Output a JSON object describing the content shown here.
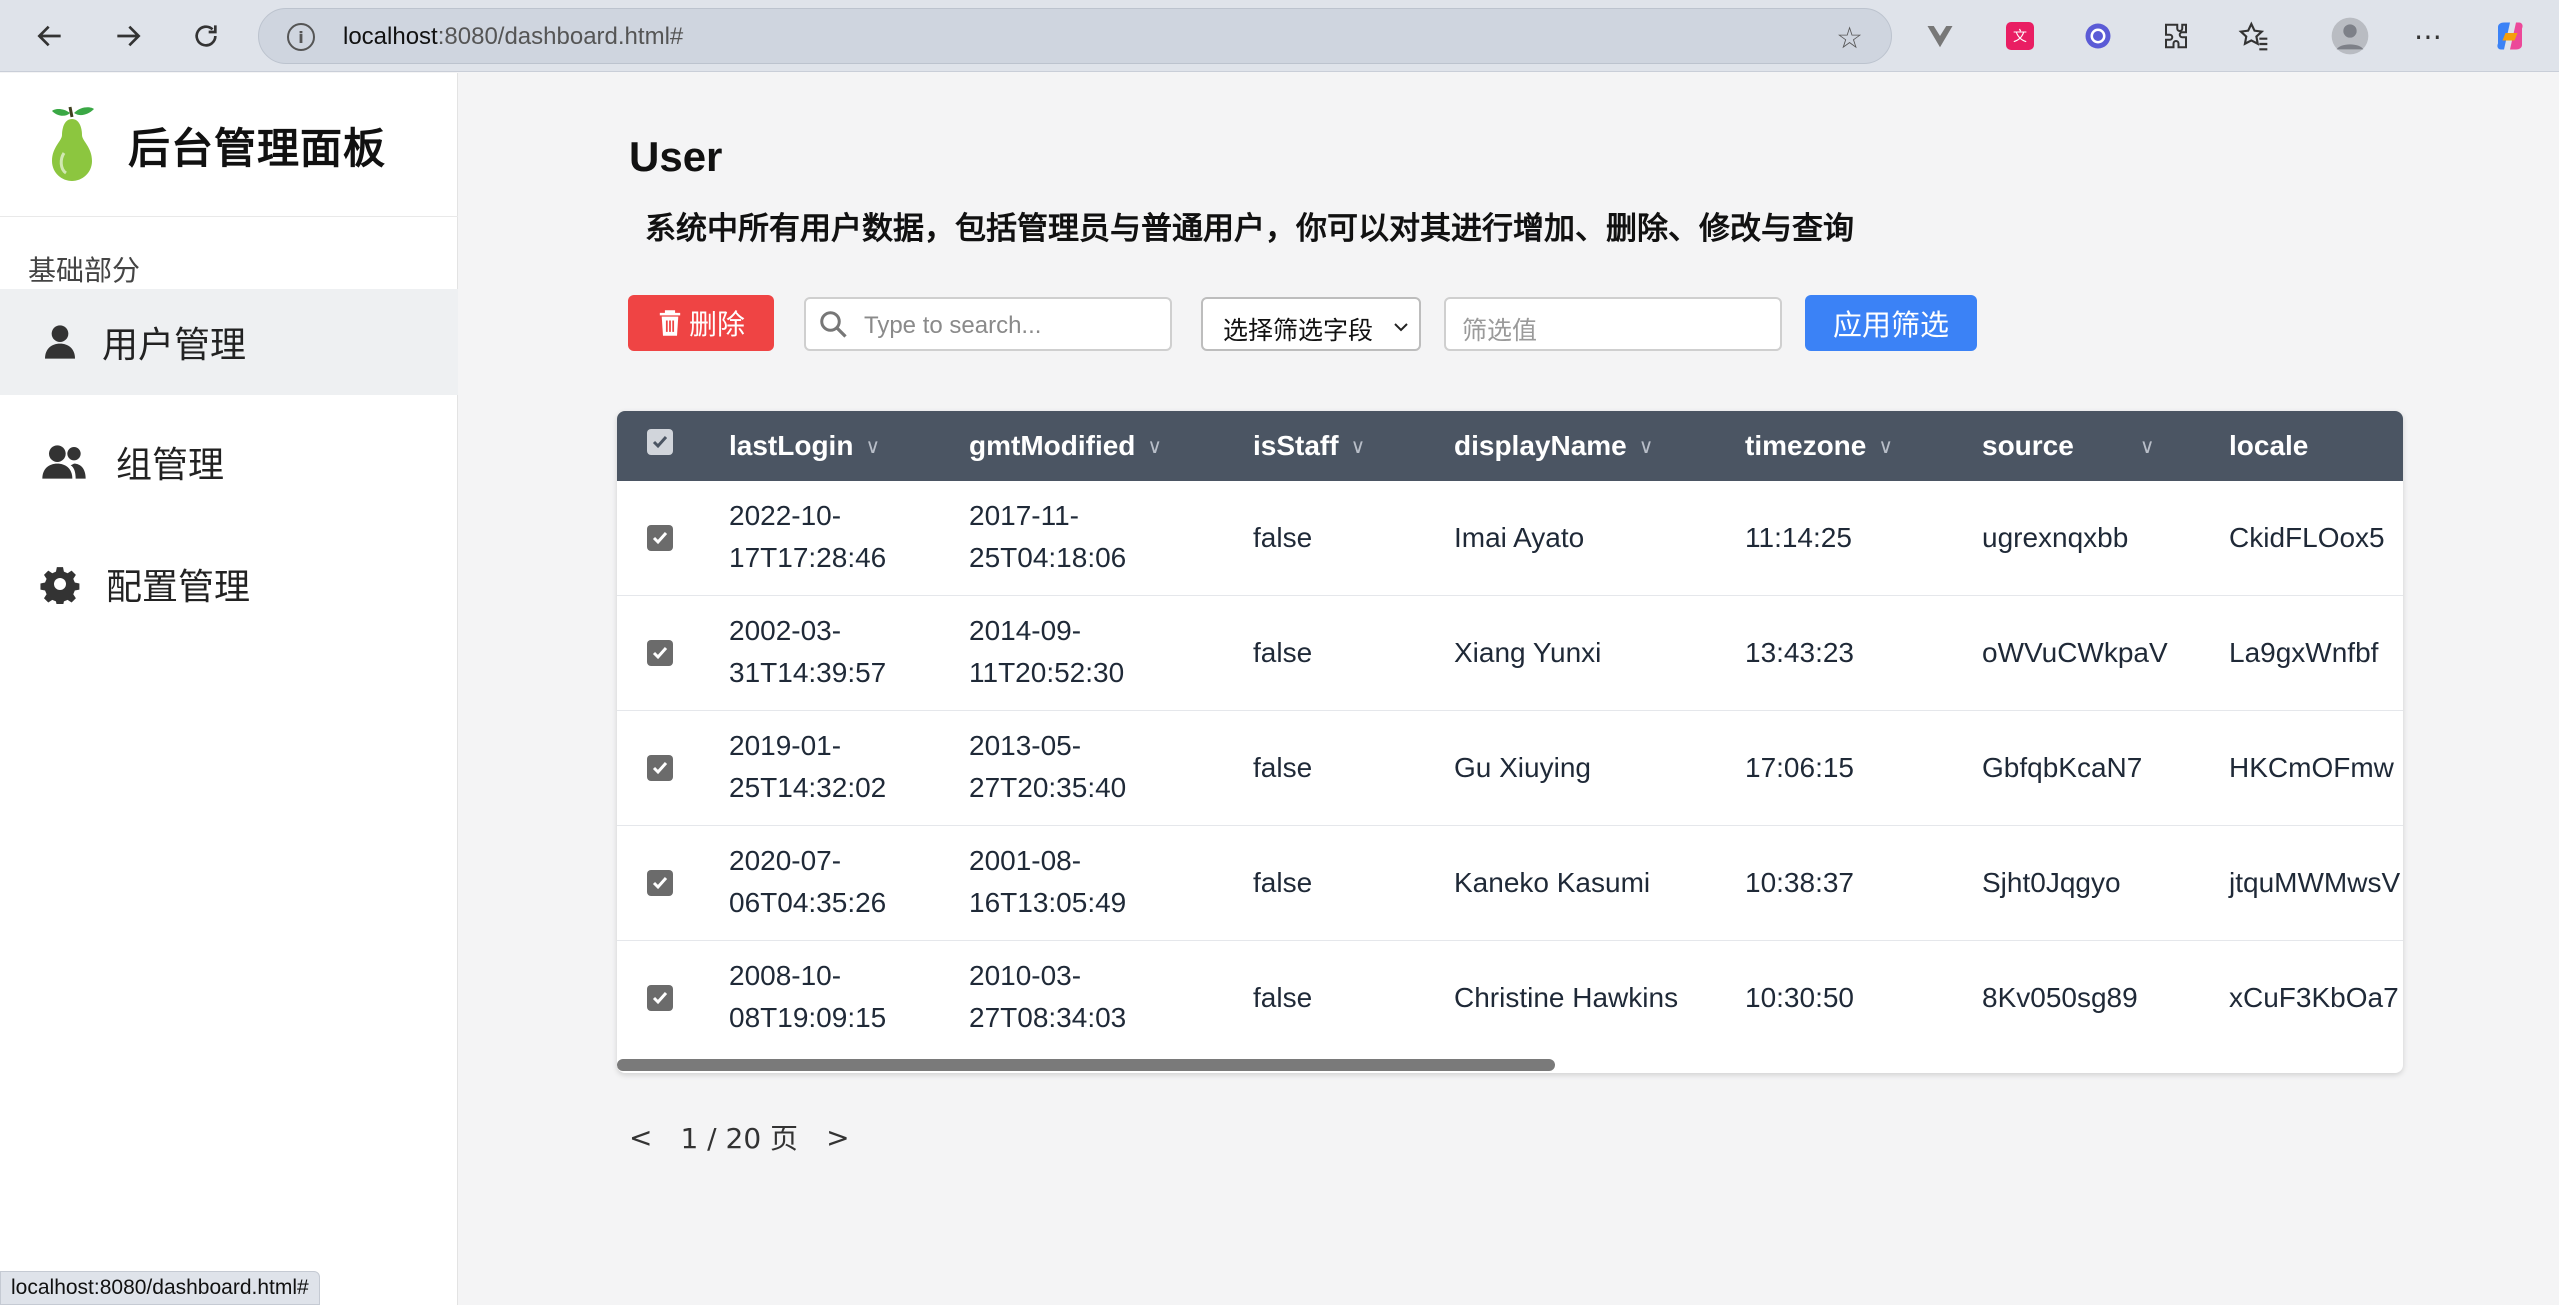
{
  "browser": {
    "url_host": "localhost",
    "url_rest": ":8080/dashboard.html#"
  },
  "sidebar": {
    "brand_title": "后台管理面板",
    "section_label": "基础部分",
    "items": [
      {
        "label": "用户管理",
        "icon": "user-icon"
      },
      {
        "label": "组管理",
        "icon": "users-icon"
      },
      {
        "label": "配置管理",
        "icon": "gear-icon"
      }
    ]
  },
  "main": {
    "title": "User",
    "description": "系统中所有用户数据，包括管理员与普通用户，你可以对其进行增加、删除、修改与查询"
  },
  "toolbar": {
    "delete_label": "删除",
    "search_placeholder": "Type to search...",
    "field_select_value": "选择筛选字段",
    "filter_placeholder": "筛选值",
    "apply_label": "应用筛选"
  },
  "table": {
    "columns": [
      "lastLogin",
      "gmtModified",
      "isStaff",
      "displayName",
      "timezone",
      "source",
      "locale"
    ],
    "rows": [
      {
        "lastLogin": [
          "2022-10-",
          "17T17:28:46"
        ],
        "gmtModified": [
          "2017-11-",
          "25T04:18:06"
        ],
        "isStaff": "false",
        "displayName": "Imai Ayato",
        "timezone": "11:14:25",
        "source": "ugrexnqxbb",
        "locale": "CkidFLOox5"
      },
      {
        "lastLogin": [
          "2002-03-",
          "31T14:39:57"
        ],
        "gmtModified": [
          "2014-09-",
          "11T20:52:30"
        ],
        "isStaff": "false",
        "displayName": "Xiang Yunxi",
        "timezone": "13:43:23",
        "source": "oWVuCWkpaV",
        "locale": "La9gxWnfbf"
      },
      {
        "lastLogin": [
          "2019-01-",
          "25T14:32:02"
        ],
        "gmtModified": [
          "2013-05-",
          "27T20:35:40"
        ],
        "isStaff": "false",
        "displayName": "Gu Xiuying",
        "timezone": "17:06:15",
        "source": "GbfqbKcaN7",
        "locale": "HKCmOFmw"
      },
      {
        "lastLogin": [
          "2020-07-",
          "06T04:35:26"
        ],
        "gmtModified": [
          "2001-08-",
          "16T13:05:49"
        ],
        "isStaff": "false",
        "displayName": "Kaneko Kasumi",
        "timezone": "10:38:37",
        "source": "Sjht0Jqgyo",
        "locale": "jtquMWMwsV"
      },
      {
        "lastLogin": [
          "2008-10-",
          "08T19:09:15"
        ],
        "gmtModified": [
          "2010-03-",
          "27T08:34:03"
        ],
        "isStaff": "false",
        "displayName": "Christine Hawkins",
        "timezone": "10:30:50",
        "source": "8Kv050sg89",
        "locale": "xCuF3KbOa7"
      }
    ]
  },
  "pager": {
    "prev": "<",
    "label": "1 / 20 页",
    "next": ">"
  },
  "status_bar": "localhost:8080/dashboard.html#",
  "colors": {
    "delete": "#ef4444",
    "apply": "#3b82f6",
    "table_header": "#4b5563"
  }
}
